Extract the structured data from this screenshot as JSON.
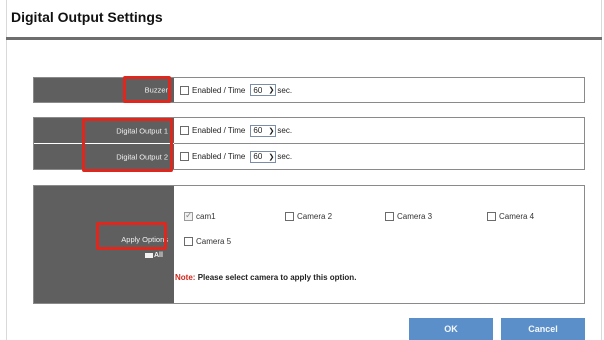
{
  "dialog": {
    "title": "Digital Output Settings"
  },
  "buzzer": {
    "label": "Buzzer",
    "enabled_label": "Enabled / Time",
    "time_value": "60",
    "unit": "sec."
  },
  "digital_outputs": [
    {
      "label": "Digital Output 1",
      "enabled_label": "Enabled / Time",
      "time_value": "60",
      "unit": "sec."
    },
    {
      "label": "Digital Output 2",
      "enabled_label": "Enabled / Time",
      "time_value": "60",
      "unit": "sec."
    }
  ],
  "apply_options": {
    "label": "Apply Options",
    "all_label": "All",
    "cameras": [
      {
        "name": "cam1",
        "checked": true
      },
      {
        "name": "Camera 2",
        "checked": false
      },
      {
        "name": "Camera 3",
        "checked": false
      },
      {
        "name": "Camera 4",
        "checked": false
      },
      {
        "name": "Camera 5",
        "checked": false
      }
    ],
    "note_prefix": "Note:",
    "note_text": "Please select camera to apply this option."
  },
  "buttons": {
    "ok": "OK",
    "cancel": "Cancel"
  },
  "colors": {
    "label_bg": "#5f5f5f",
    "highlight": "#e0271d",
    "button": "#5b8fc9"
  }
}
